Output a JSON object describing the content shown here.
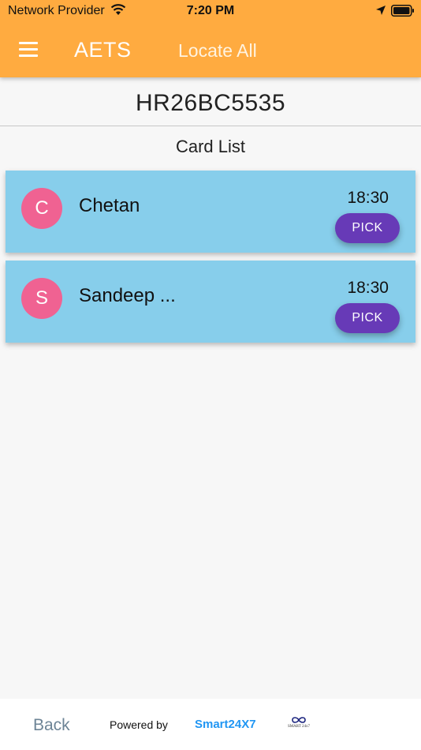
{
  "status_bar": {
    "carrier": "Network Provider",
    "time": "7:20 PM"
  },
  "header": {
    "title": "AETS",
    "locate_all": "Locate All"
  },
  "vehicle_number": "HR26BC5535",
  "section_title": "Card List",
  "cards": [
    {
      "initial": "C",
      "name": "Chetan",
      "time": "18:30",
      "action": "PICK"
    },
    {
      "initial": "S",
      "name": "Sandeep ...",
      "time": "18:30",
      "action": "PICK"
    }
  ],
  "footer": {
    "back": "Back",
    "powered_by": "Powered by",
    "brand": "Smart24X7",
    "logo_text": "SMART 24x7"
  },
  "colors": {
    "header": "#ffab40",
    "card": "#87ceeb",
    "avatar": "#f06292",
    "pick_button": "#673ab7",
    "brand": "#2196f3"
  }
}
